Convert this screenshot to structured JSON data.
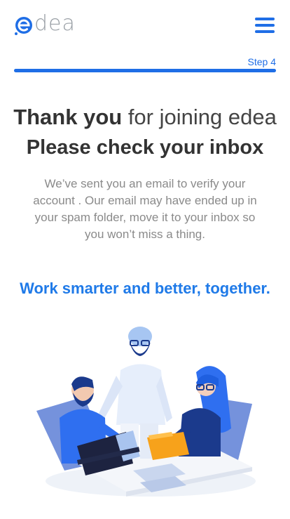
{
  "brand": {
    "logo_text": "dea",
    "logo_initial": "e"
  },
  "header": {
    "menu_icon": "hamburger-menu-icon"
  },
  "progress": {
    "step_label": "Step 4",
    "fraction": 1.0
  },
  "headline": {
    "bold": "Thank you",
    "light": " for joining edea",
    "line2": "Please check your inbox"
  },
  "message": "We’ve sent you an email to verify your account . Our email may have ended up in your spam folder,  move it to your inbox so you won’t miss a thing.",
  "tagline": "Work smarter and better, together.",
  "colors": {
    "accent": "#1f6ee6",
    "accent_light": "#2f8cf0",
    "text_dark": "#333333",
    "text_muted": "#8a8a8a",
    "logo_gray": "#9aa0a6"
  },
  "illustration": {
    "icon": "team-collaboration-illustration"
  }
}
